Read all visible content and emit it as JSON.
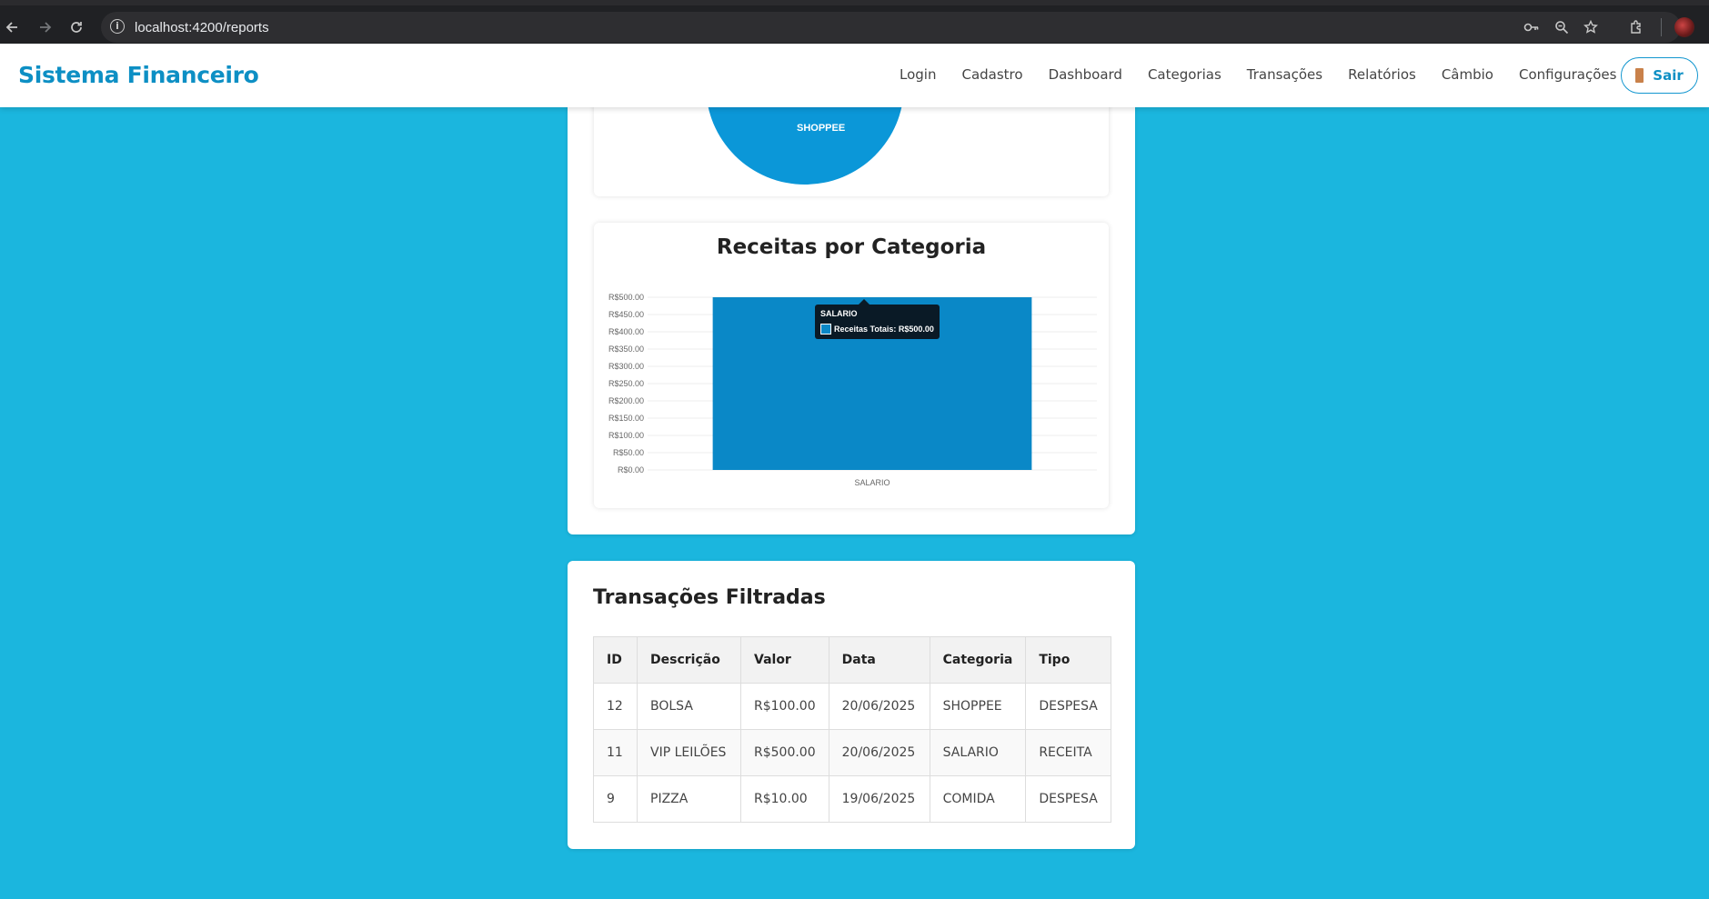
{
  "browser": {
    "url": "localhost:4200/reports"
  },
  "header": {
    "brand": "Sistema Financeiro",
    "nav": [
      "Login",
      "Cadastro",
      "Dashboard",
      "Categorias",
      "Transações",
      "Relatórios",
      "Câmbio",
      "Configurações"
    ],
    "logout_label": "Sair"
  },
  "pie": {
    "visible_slice_label": "SHOPPEE",
    "color": "#0b97d8"
  },
  "income_chart": {
    "title": "Receitas por Categoria",
    "tooltip": {
      "title": "SALARIO",
      "label": "Receitas Totais: R$500.00"
    }
  },
  "chart_data": {
    "type": "bar",
    "title": "Receitas por Categoria",
    "categories": [
      "SALARIO"
    ],
    "series": [
      {
        "name": "Receitas Totais",
        "values": [
          500
        ]
      }
    ],
    "ylim": [
      0,
      500
    ],
    "yticks": [
      "R$0.00",
      "R$50.00",
      "R$100.00",
      "R$150.00",
      "R$200.00",
      "R$250.00",
      "R$300.00",
      "R$350.00",
      "R$400.00",
      "R$450.00",
      "R$500.00"
    ],
    "bar_color": "#0a88c7",
    "grid": true,
    "legend": "none"
  },
  "transactions": {
    "title": "Transações Filtradas",
    "columns": [
      "ID",
      "Descrição",
      "Valor",
      "Data",
      "Categoria",
      "Tipo"
    ],
    "rows": [
      [
        "12",
        "BOLSA",
        "R$100.00",
        "20/06/2025",
        "SHOPPEE",
        "DESPESA"
      ],
      [
        "11",
        "VIP LEILÕES",
        "R$500.00",
        "20/06/2025",
        "SALARIO",
        "RECEITA"
      ],
      [
        "9",
        "PIZZA",
        "R$10.00",
        "19/06/2025",
        "COMIDA",
        "DESPESA"
      ]
    ]
  }
}
